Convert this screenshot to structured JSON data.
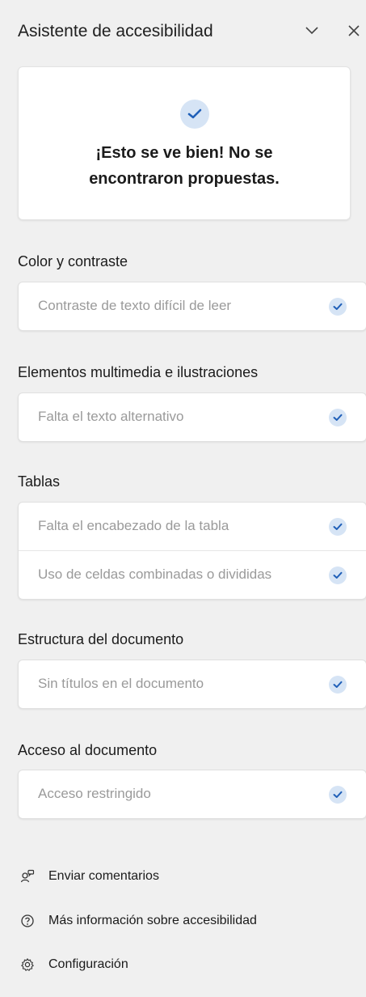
{
  "header": {
    "title": "Asistente de accesibilidad"
  },
  "status": {
    "message_line1": "¡Esto se ve bien! No se",
    "message_line2": "encontraron propuestas."
  },
  "sections": [
    {
      "title": "Color y contraste",
      "items": [
        "Contraste de texto difícil de leer"
      ]
    },
    {
      "title": "Elementos multimedia e ilustraciones",
      "items": [
        "Falta el texto alternativo"
      ]
    },
    {
      "title": "Tablas",
      "items": [
        "Falta el encabezado de la tabla",
        "Uso de celdas combinadas o divididas"
      ]
    },
    {
      "title": "Estructura del documento",
      "items": [
        "Sin títulos en el documento"
      ]
    },
    {
      "title": "Acceso al documento",
      "items": [
        "Acceso restringido"
      ]
    }
  ],
  "footer": {
    "feedback": "Enviar comentarios",
    "learn_more": "Más información sobre accesibilidad",
    "settings": "Configuración"
  },
  "colors": {
    "check_bg": "#d6e4f5",
    "check_fg": "#1f5fb8",
    "panel_bg": "#f0f0f0"
  }
}
